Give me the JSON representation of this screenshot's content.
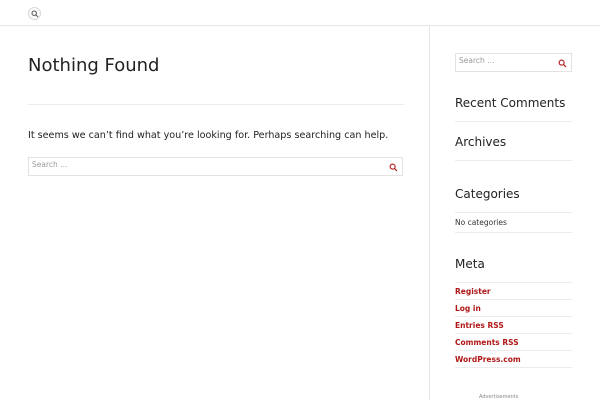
{
  "header": {
    "search_icon": "search-icon"
  },
  "main": {
    "title": "Nothing Found",
    "message": "It seems we can’t find what you’re looking for. Perhaps searching can help.",
    "search_placeholder": "Search …"
  },
  "sidebar": {
    "search_placeholder": "Search …",
    "recent_comments_title": "Recent Comments",
    "archives_title": "Archives",
    "categories_title": "Categories",
    "categories_empty": "No categories",
    "meta_title": "Meta",
    "meta_links": [
      "Register",
      "Log in",
      "Entries RSS",
      "Comments RSS",
      "WordPress.com"
    ]
  },
  "footer": {
    "ads_label": "Advertisements"
  },
  "colors": {
    "link": "#b01818",
    "rule": "#ececec",
    "text": "#222222"
  }
}
